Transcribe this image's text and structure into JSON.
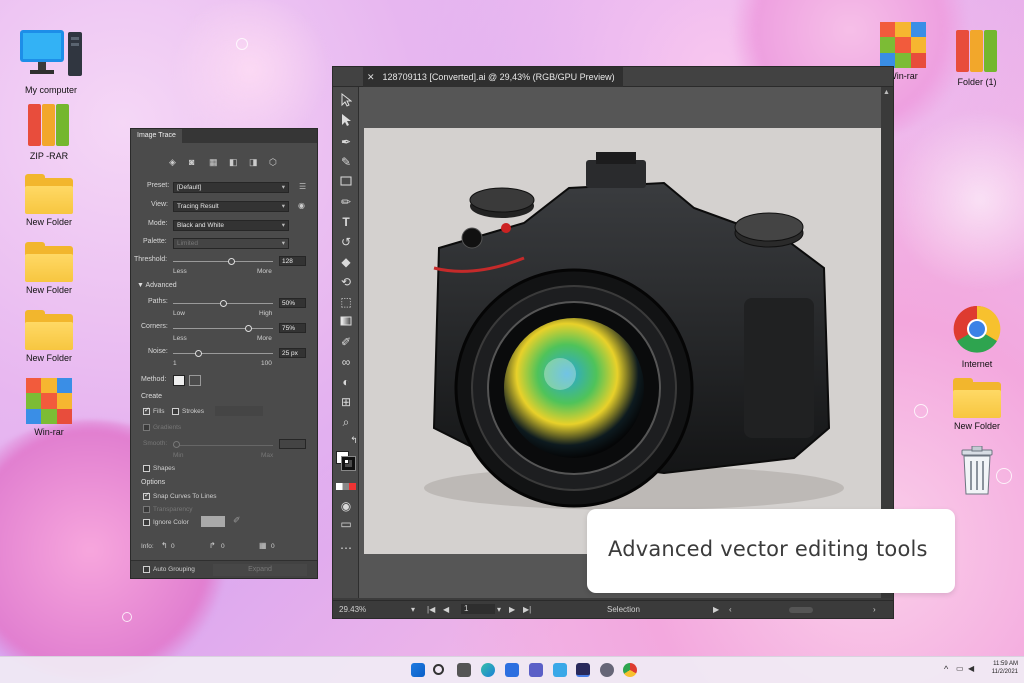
{
  "desktop": {
    "icons_left": [
      {
        "label": "My computer",
        "kind": "computer"
      },
      {
        "label": "ZIP -RAR",
        "kind": "binders"
      },
      {
        "label": "New Folder",
        "kind": "folder"
      },
      {
        "label": "New Folder",
        "kind": "folder"
      },
      {
        "label": "New Folder",
        "kind": "folder"
      },
      {
        "label": "Win-rar",
        "kind": "winrar"
      }
    ],
    "icons_right": [
      {
        "label": "Win-rar",
        "kind": "winrar"
      },
      {
        "label": "Folder (1)",
        "kind": "binders"
      },
      {
        "label": "Internet",
        "kind": "chrome"
      },
      {
        "label": "New Folder",
        "kind": "folder"
      },
      {
        "label": "",
        "kind": "trash"
      }
    ]
  },
  "illustrator": {
    "document_tab": "128709113 [Converted].ai @ 29,43% (RGB/GPU Preview)",
    "close_glyph": "✕",
    "status": {
      "zoom": "29.43%",
      "artboard": "1",
      "mode": "Selection"
    }
  },
  "image_trace": {
    "title": "Image Trace",
    "preset_label": "Preset:",
    "preset_value": "[Default]",
    "view_label": "View:",
    "view_value": "Tracing Result",
    "mode_label": "Mode:",
    "mode_value": "Black and White",
    "palette_label": "Palette:",
    "palette_value": "Limited",
    "threshold_label": "Threshold:",
    "threshold_value": "128",
    "less": "Less",
    "more": "More",
    "advanced": "Advanced",
    "paths_label": "Paths:",
    "paths_value": "50%",
    "low": "Low",
    "high": "High",
    "corners_label": "Corners:",
    "corners_value": "75%",
    "noise_label": "Noise:",
    "noise_value": "25 px",
    "noise_min": "1",
    "noise_max": "100",
    "method_label": "Method:",
    "create_label": "Create",
    "fills": "Fills",
    "strokes": "Strokes",
    "gradients": "Gradients",
    "smooth": "Smooth:",
    "smooth_min": "Min",
    "smooth_max": "Max",
    "shapes": "Shapes",
    "options_label": "Options",
    "snap_curves": "Snap Curves To Lines",
    "transparency": "Transparency",
    "ignore_color": "Ignore Color",
    "info_label": "Info:",
    "info_paths": "0",
    "info_anchors": "0",
    "info_colors": "0",
    "auto_grouping": "Auto Grouping",
    "expand": "Expand",
    "threshold_fraction": 0.58,
    "paths_fraction": 0.5,
    "corners_fraction": 0.75,
    "noise_fraction": 0.25
  },
  "callout": {
    "text": "Advanced vector editing tools"
  },
  "taskbar": {
    "time": "11:59 AM",
    "date": "11/2/2021"
  },
  "colors": {
    "folder": "#f2b62d",
    "panel": "#4b4b4b",
    "canvas": "#565656",
    "artboard": "#d4d1cf"
  }
}
